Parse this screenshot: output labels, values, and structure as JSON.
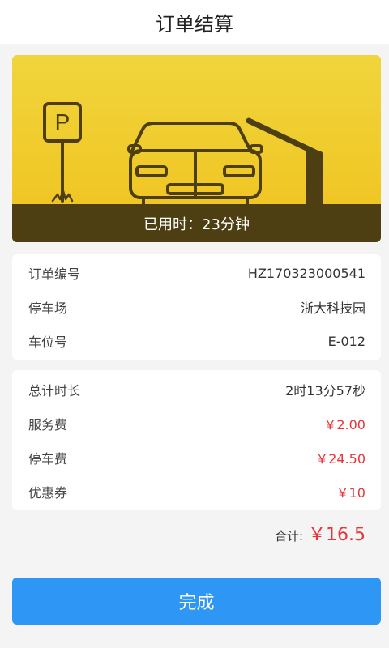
{
  "header": {
    "title": "订单结算"
  },
  "banner": {
    "used_time_text": "已用时：23分钟",
    "parking_sign_letter": "P",
    "illustration": "car-at-parking-gate"
  },
  "order_info": {
    "rows": [
      {
        "label": "订单编号",
        "value": "HZ170323000541"
      },
      {
        "label": "停车场",
        "value": "浙大科技园"
      },
      {
        "label": "车位号",
        "value": "E-012"
      }
    ]
  },
  "fee_info": {
    "rows": [
      {
        "label": "总计时长",
        "value": "2时13分57秒"
      },
      {
        "label": "服务费",
        "value": "￥2.00"
      },
      {
        "label": "停车费",
        "value": "￥24.50"
      },
      {
        "label": "优惠券",
        "value": "￥10"
      }
    ]
  },
  "total": {
    "label": "合计:",
    "amount": "￥16.5"
  },
  "actions": {
    "done_label": "完成"
  },
  "colors": {
    "accent": "#2e96f5",
    "price_red": "#e8353a",
    "banner_yellow": "#f0c21e",
    "ground_brown": "#4d3f12"
  }
}
